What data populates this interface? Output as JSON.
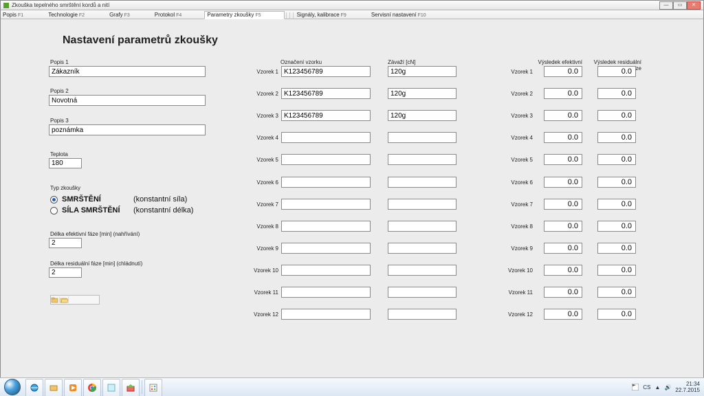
{
  "window": {
    "title": "Zkouška tepelného smrštění kordů a nití"
  },
  "menu": {
    "items": [
      {
        "label": "Popis",
        "fk": "F1"
      },
      {
        "label": "Technologie",
        "fk": "F2"
      },
      {
        "label": "Grafy",
        "fk": "F3"
      },
      {
        "label": "Protokol",
        "fk": "F4"
      },
      {
        "label": "Parametry zkoušky",
        "fk": "F5"
      },
      {
        "label": "Signály, kalibrace",
        "fk": "F9"
      },
      {
        "label": "Servisní nastavení",
        "fk": "F10"
      }
    ],
    "active_index": 4
  },
  "page": {
    "title": "Nastavení parametrů zkoušky",
    "section_labels": {
      "popis1": "Popis 1",
      "popis2": "Popis 2",
      "popis3": "Popis 3",
      "teplota": "Teplota",
      "typ": "Typ zkoušky",
      "delka_eff": "Délka efektivní fáze [min]  (nahřívání)",
      "delka_res": "Délka residuální fáze [min]  (chládnutí)",
      "oznaceni": "Označení vzorku",
      "zavazi": "Závaží [cN]",
      "vys_eff": "Výsledek efektivní fáze",
      "vys_res": "Výsledek residuální fáze"
    },
    "popis1": "Zákazník",
    "popis2": "Novotná",
    "popis3": "poznámka",
    "teplota": "180",
    "radios": [
      {
        "main": "SMRŠTĚNÍ",
        "sub": "(konstantní síla)"
      },
      {
        "main": "SÍLA SMRŠTĚNÍ",
        "sub": "(konstantní délka)"
      }
    ],
    "radio_selected": 0,
    "delka_eff": "2",
    "delka_res": "2",
    "samples": [
      {
        "label": "Vzorek 1",
        "oznaceni": "K123456789",
        "zavazi": "120g",
        "eff": "0.0",
        "res": "0.0"
      },
      {
        "label": "Vzorek 2",
        "oznaceni": "K123456789",
        "zavazi": "120g",
        "eff": "0.0",
        "res": "0.0"
      },
      {
        "label": "Vzorek 3",
        "oznaceni": "K123456789",
        "zavazi": "120g",
        "eff": "0.0",
        "res": "0.0"
      },
      {
        "label": "Vzorek 4",
        "oznaceni": "",
        "zavazi": "",
        "eff": "0.0",
        "res": "0.0"
      },
      {
        "label": "Vzorek 5",
        "oznaceni": "",
        "zavazi": "",
        "eff": "0.0",
        "res": "0.0"
      },
      {
        "label": "Vzorek 6",
        "oznaceni": "",
        "zavazi": "",
        "eff": "0.0",
        "res": "0.0"
      },
      {
        "label": "Vzorek 7",
        "oznaceni": "",
        "zavazi": "",
        "eff": "0.0",
        "res": "0.0"
      },
      {
        "label": "Vzorek 8",
        "oznaceni": "",
        "zavazi": "",
        "eff": "0.0",
        "res": "0.0"
      },
      {
        "label": "Vzorek 9",
        "oznaceni": "",
        "zavazi": "",
        "eff": "0.0",
        "res": "0.0"
      },
      {
        "label": "Vzorek 10",
        "oznaceni": "",
        "zavazi": "",
        "eff": "0.0",
        "res": "0.0"
      },
      {
        "label": "Vzorek 11",
        "oznaceni": "",
        "zavazi": "",
        "eff": "0.0",
        "res": "0.0"
      },
      {
        "label": "Vzorek 12",
        "oznaceni": "",
        "zavazi": "",
        "eff": "0.0",
        "res": "0.0"
      }
    ]
  },
  "tray": {
    "lang": "CS",
    "time": "21:34",
    "date": "22.7.2015"
  }
}
